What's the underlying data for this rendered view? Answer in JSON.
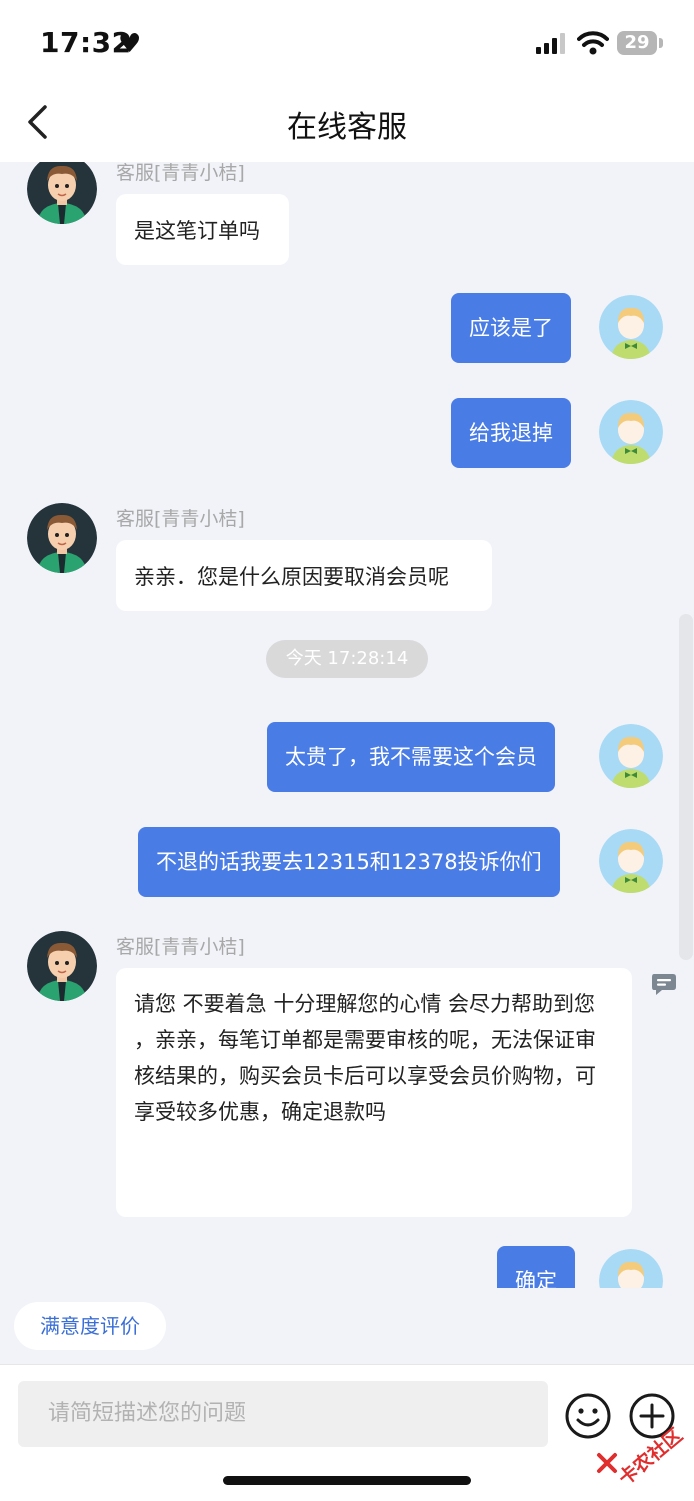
{
  "status_bar": {
    "time": "17:32",
    "battery": "29",
    "icons": [
      "heart-icon",
      "signal-icon",
      "wifi-icon",
      "battery-icon"
    ]
  },
  "nav": {
    "title": "在线客服",
    "back_icon": "chevron-left-icon"
  },
  "messages": [
    {
      "from": "agent",
      "name": "客服[青青小桔]",
      "text": "是这笔订单吗"
    },
    {
      "from": "user",
      "text": "应该是了"
    },
    {
      "from": "user",
      "text": "给我退掉"
    },
    {
      "from": "agent",
      "name": "客服[青青小桔]",
      "text": "亲亲．您是什么原因要取消会员呢"
    },
    {
      "from": "system",
      "text": "今天 17:28:14"
    },
    {
      "from": "user",
      "text": "太贵了，我不需要这个会员"
    },
    {
      "from": "user",
      "text": "不退的话我要去12315和12378投诉你们"
    },
    {
      "from": "agent",
      "name": "客服[青青小桔]",
      "text": "请您 不要着急 十分理解您的心情 会尽力帮助到您 ，亲亲，每笔订单都是需要审核的呢，无法保证审核结果的，购买会员卡后可以享受会员价购物，可享受较多优惠，确定退款吗"
    },
    {
      "from": "user",
      "text": "确定"
    }
  ],
  "rate_button": "满意度评价",
  "input": {
    "placeholder": "请简短描述您的问题"
  },
  "watermark": "卡农社区",
  "colors": {
    "user_bubble": "#4a7ce6",
    "agent_bubble": "#ffffff",
    "background": "#f1f3f8",
    "link": "#3b6fd6"
  }
}
